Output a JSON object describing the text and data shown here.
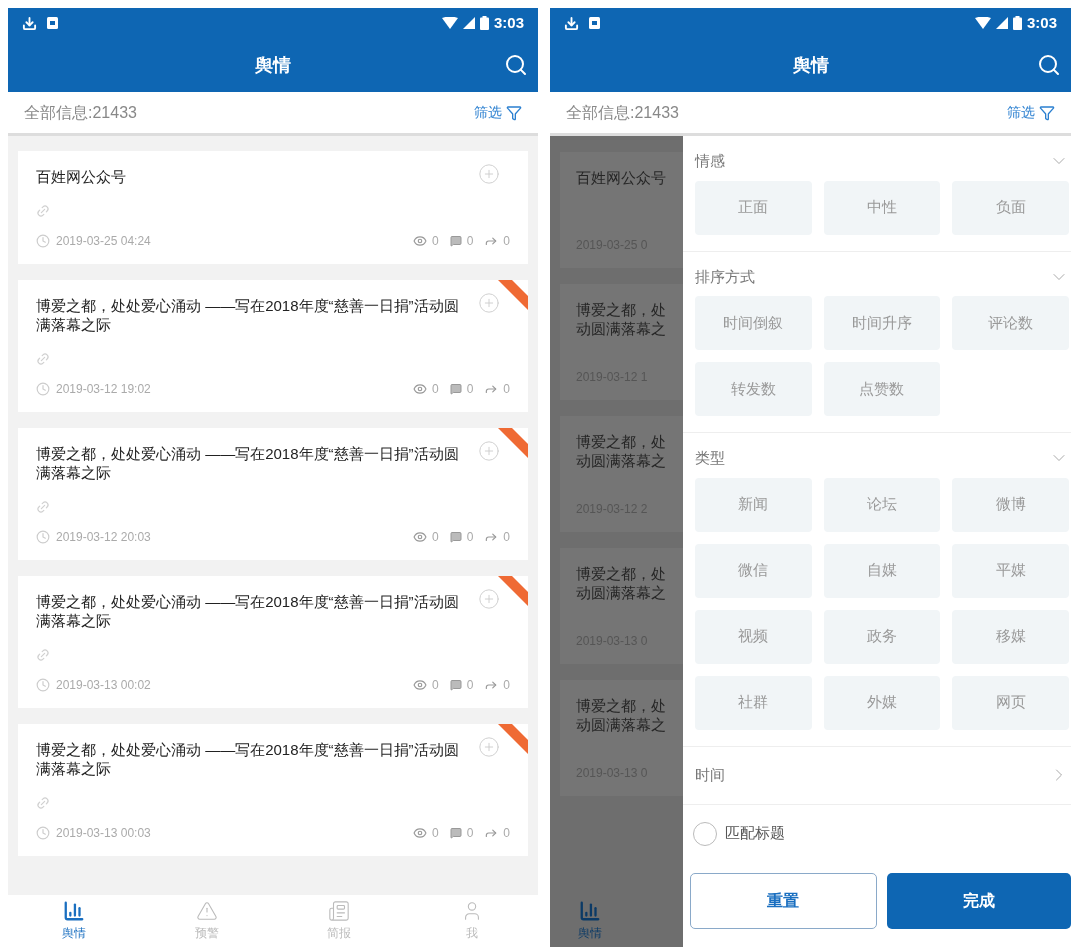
{
  "list_screen": {
    "status_bar": {
      "time": "3:03"
    },
    "title": "舆情",
    "total": "全部信息:21433",
    "filter_label": "筛选",
    "items": [
      {
        "title": "百姓网公众号",
        "time": "2019-03-25 04:24",
        "views": "0",
        "comments": "0",
        "shares": "0",
        "flagged": false
      },
      {
        "title": "博爱之都，处处爱心涌动 ——写在2018年度“慈善一日捐”活动圆满落幕之际",
        "time": "2019-03-12 19:02",
        "views": "0",
        "comments": "0",
        "shares": "0",
        "flagged": true
      },
      {
        "title": "博爱之都，处处爱心涌动 ——写在2018年度“慈善一日捐”活动圆满落幕之际",
        "time": "2019-03-12 20:03",
        "views": "0",
        "comments": "0",
        "shares": "0",
        "flagged": true
      },
      {
        "title": "博爱之都，处处爱心涌动 ——写在2018年度“慈善一日捐”活动圆满落幕之际",
        "time": "2019-03-13 00:02",
        "views": "0",
        "comments": "0",
        "shares": "0",
        "flagged": true
      },
      {
        "title": "博爱之都，处处爱心涌动 ——写在2018年度“慈善一日捐”活动圆满落幕之际",
        "time": "2019-03-13 00:03",
        "views": "0",
        "comments": "0",
        "shares": "0",
        "flagged": true
      }
    ],
    "nav": [
      {
        "label": "舆情",
        "selected": true
      },
      {
        "label": "预警",
        "selected": false
      },
      {
        "label": "简报",
        "selected": false
      },
      {
        "label": "我",
        "selected": false
      }
    ]
  },
  "filter_screen": {
    "status_bar": {
      "time": "3:03"
    },
    "title": "舆情",
    "total": "全部信息:21433",
    "filter_label": "筛选",
    "background_items": [
      {
        "lines": [
          "百姓网公众号"
        ],
        "time": "2019-03-25 0"
      },
      {
        "lines": [
          "博爱之都，处",
          "动圆满落幕之"
        ],
        "time": "2019-03-12 1"
      },
      {
        "lines": [
          "博爱之都，处",
          "动圆满落幕之"
        ],
        "time": "2019-03-12 2"
      },
      {
        "lines": [
          "博爱之都，处",
          "动圆满落幕之"
        ],
        "time": "2019-03-13 0"
      },
      {
        "lines": [
          "博爱之都，处",
          "动圆满落幕之"
        ],
        "time": "2019-03-13 0"
      }
    ],
    "background_nav": [
      {
        "label": "舆情",
        "selected": true
      }
    ],
    "drawer": {
      "sections": [
        {
          "title": "情感",
          "expanded": true,
          "options": [
            {
              "label": "正面",
              "selected": false
            },
            {
              "label": "中性",
              "selected": false
            },
            {
              "label": "负面",
              "selected": false
            }
          ]
        },
        {
          "title": "排序方式",
          "expanded": true,
          "options": [
            {
              "label": "时间倒叙",
              "selected": false
            },
            {
              "label": "时间升序",
              "selected": false
            },
            {
              "label": "评论数",
              "selected": false
            },
            {
              "label": "转发数",
              "selected": false
            },
            {
              "label": "点赞数",
              "selected": false
            }
          ]
        },
        {
          "title": "类型",
          "expanded": true,
          "options": [
            {
              "label": "新闻",
              "selected": false
            },
            {
              "label": "论坛",
              "selected": false
            },
            {
              "label": "微博",
              "selected": false
            },
            {
              "label": "微信",
              "selected": false
            },
            {
              "label": "自媒",
              "selected": false
            },
            {
              "label": "平媒",
              "selected": false
            },
            {
              "label": "视频",
              "selected": false
            },
            {
              "label": "政务",
              "selected": false
            },
            {
              "label": "移媒",
              "selected": false
            },
            {
              "label": "社群",
              "selected": false
            },
            {
              "label": "外媒",
              "selected": false
            },
            {
              "label": "网页",
              "selected": false
            }
          ]
        }
      ],
      "time_row": {
        "label": "时间"
      },
      "match_title": {
        "label": "匹配标题",
        "checked": false
      },
      "buttons": [
        {
          "label": "重置",
          "kind": "outline"
        },
        {
          "label": "完成",
          "kind": "primary"
        }
      ]
    }
  }
}
